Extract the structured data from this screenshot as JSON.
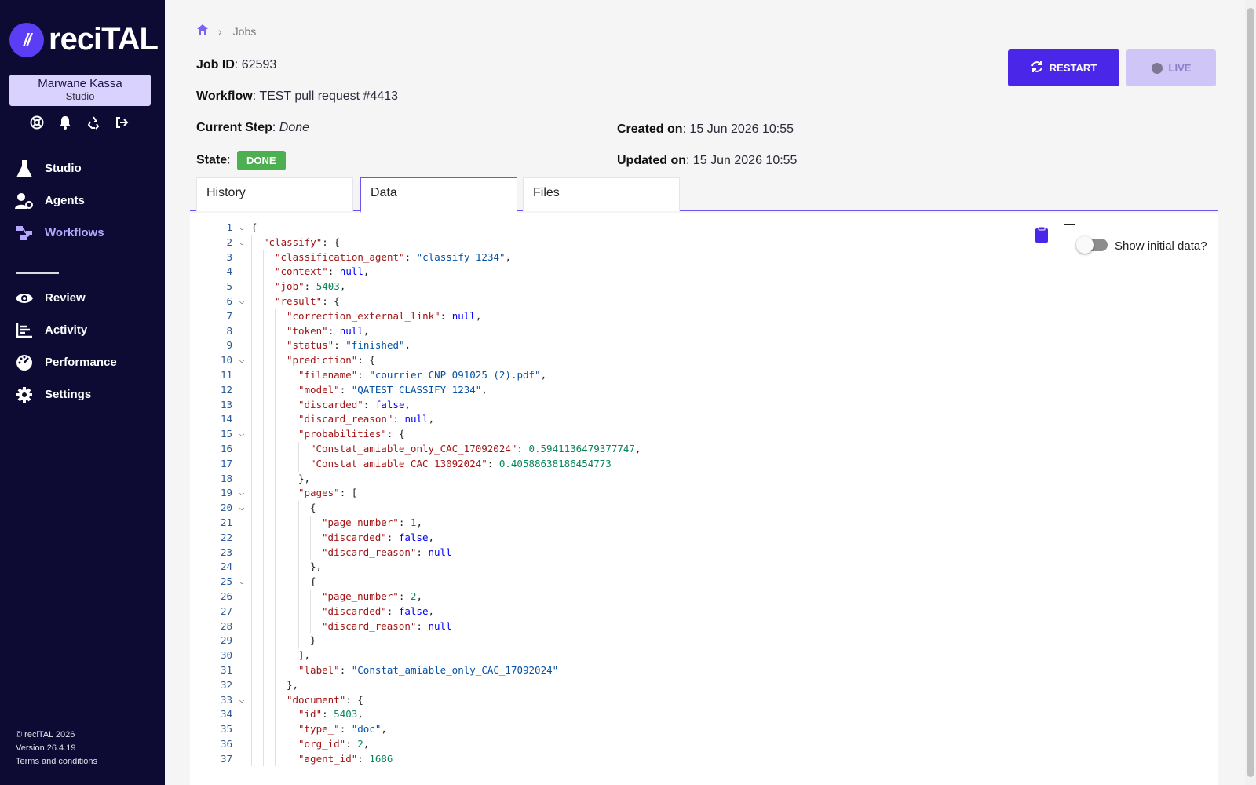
{
  "app": {
    "logo_text": "reciTAL",
    "logo_mark": "//"
  },
  "user": {
    "name": "Marwane Kassa",
    "role": "Studio"
  },
  "util_icons": [
    "support-icon",
    "bell-icon",
    "recycle-icon",
    "logout-icon"
  ],
  "nav": {
    "primary": [
      {
        "label": "Studio",
        "icon": "flask-icon"
      },
      {
        "label": "Agents",
        "icon": "agents-icon"
      },
      {
        "label": "Workflows",
        "icon": "workflow-icon",
        "active": true
      }
    ],
    "secondary": [
      {
        "label": "Review",
        "icon": "eye-icon"
      },
      {
        "label": "Activity",
        "icon": "activity-icon"
      },
      {
        "label": "Performance",
        "icon": "gauge-icon"
      },
      {
        "label": "Settings",
        "icon": "gear-icon"
      }
    ]
  },
  "footer": {
    "copyright": "© reciTAL 2026",
    "version": "Version 26.4.19",
    "terms": "Terms and conditions"
  },
  "breadcrumb": {
    "home_icon": "home-icon",
    "current": "Jobs"
  },
  "job": {
    "id_label": "Job ID",
    "id_value": "62593",
    "workflow_label": "Workflow",
    "workflow_value": "TEST pull request #4413",
    "step_label": "Current Step",
    "step_value": "Done",
    "state_label": "State",
    "state_value": "DONE",
    "created_label": "Created on",
    "created_value": "15 Jun 2026 10:55",
    "updated_label": "Updated on",
    "updated_value": "15 Jun 2026 10:55"
  },
  "actions": {
    "restart_label": "RESTART",
    "live_label": "LIVE"
  },
  "tabs": [
    {
      "label": "History"
    },
    {
      "label": "Data",
      "active": true
    },
    {
      "label": "Files"
    }
  ],
  "toggle": {
    "label": "Show initial data?",
    "checked": false
  },
  "colors": {
    "sidebar_bg": "#0d0a33",
    "accent": "#4a26e8",
    "done_badge": "#4cb050"
  },
  "code_lines": [
    {
      "n": "1",
      "fold": true,
      "indent": 0,
      "t": [
        [
          "p",
          "{"
        ]
      ]
    },
    {
      "n": "2",
      "fold": true,
      "indent": 1,
      "t": [
        [
          "k",
          "\"classify\""
        ],
        [
          "p",
          ": {"
        ]
      ]
    },
    {
      "n": "3",
      "fold": false,
      "indent": 2,
      "t": [
        [
          "k",
          "\"classification_agent\""
        ],
        [
          "p",
          ": "
        ],
        [
          "s",
          "\"classify 1234\""
        ],
        [
          "p",
          ","
        ]
      ]
    },
    {
      "n": "4",
      "fold": false,
      "indent": 2,
      "t": [
        [
          "k",
          "\"context\""
        ],
        [
          "p",
          ": "
        ],
        [
          "kw",
          "null"
        ],
        [
          "p",
          ","
        ]
      ]
    },
    {
      "n": "5",
      "fold": false,
      "indent": 2,
      "t": [
        [
          "k",
          "\"job\""
        ],
        [
          "p",
          ": "
        ],
        [
          "n",
          "5403"
        ],
        [
          "p",
          ","
        ]
      ]
    },
    {
      "n": "6",
      "fold": true,
      "indent": 2,
      "t": [
        [
          "k",
          "\"result\""
        ],
        [
          "p",
          ": {"
        ]
      ]
    },
    {
      "n": "7",
      "fold": false,
      "indent": 3,
      "t": [
        [
          "k",
          "\"correction_external_link\""
        ],
        [
          "p",
          ": "
        ],
        [
          "kw",
          "null"
        ],
        [
          "p",
          ","
        ]
      ]
    },
    {
      "n": "8",
      "fold": false,
      "indent": 3,
      "t": [
        [
          "k",
          "\"token\""
        ],
        [
          "p",
          ": "
        ],
        [
          "kw",
          "null"
        ],
        [
          "p",
          ","
        ]
      ]
    },
    {
      "n": "9",
      "fold": false,
      "indent": 3,
      "t": [
        [
          "k",
          "\"status\""
        ],
        [
          "p",
          ": "
        ],
        [
          "s",
          "\"finished\""
        ],
        [
          "p",
          ","
        ]
      ]
    },
    {
      "n": "10",
      "fold": true,
      "indent": 3,
      "t": [
        [
          "k",
          "\"prediction\""
        ],
        [
          "p",
          ": {"
        ]
      ]
    },
    {
      "n": "11",
      "fold": false,
      "indent": 4,
      "t": [
        [
          "k",
          "\"filename\""
        ],
        [
          "p",
          ": "
        ],
        [
          "s",
          "\"courrier CNP 091025 (2).pdf\""
        ],
        [
          "p",
          ","
        ]
      ]
    },
    {
      "n": "12",
      "fold": false,
      "indent": 4,
      "t": [
        [
          "k",
          "\"model\""
        ],
        [
          "p",
          ": "
        ],
        [
          "s",
          "\"QATEST CLASSIFY 1234\""
        ],
        [
          "p",
          ","
        ]
      ]
    },
    {
      "n": "13",
      "fold": false,
      "indent": 4,
      "t": [
        [
          "k",
          "\"discarded\""
        ],
        [
          "p",
          ": "
        ],
        [
          "kw",
          "false"
        ],
        [
          "p",
          ","
        ]
      ]
    },
    {
      "n": "14",
      "fold": false,
      "indent": 4,
      "t": [
        [
          "k",
          "\"discard_reason\""
        ],
        [
          "p",
          ": "
        ],
        [
          "kw",
          "null"
        ],
        [
          "p",
          ","
        ]
      ]
    },
    {
      "n": "15",
      "fold": true,
      "indent": 4,
      "t": [
        [
          "k",
          "\"probabilities\""
        ],
        [
          "p",
          ": {"
        ]
      ]
    },
    {
      "n": "16",
      "fold": false,
      "indent": 5,
      "t": [
        [
          "k",
          "\"Constat_amiable_only_CAC_17092024\""
        ],
        [
          "p",
          ": "
        ],
        [
          "n",
          "0.5941136479377747"
        ],
        [
          "p",
          ","
        ]
      ]
    },
    {
      "n": "17",
      "fold": false,
      "indent": 5,
      "t": [
        [
          "k",
          "\"Constat_amiable_CAC_13092024\""
        ],
        [
          "p",
          ": "
        ],
        [
          "n",
          "0.40588638186454773"
        ]
      ]
    },
    {
      "n": "18",
      "fold": false,
      "indent": 4,
      "t": [
        [
          "p",
          "},"
        ]
      ]
    },
    {
      "n": "19",
      "fold": true,
      "indent": 4,
      "t": [
        [
          "k",
          "\"pages\""
        ],
        [
          "p",
          ": ["
        ]
      ]
    },
    {
      "n": "20",
      "fold": true,
      "indent": 5,
      "t": [
        [
          "p",
          "{"
        ]
      ]
    },
    {
      "n": "21",
      "fold": false,
      "indent": 6,
      "t": [
        [
          "k",
          "\"page_number\""
        ],
        [
          "p",
          ": "
        ],
        [
          "n",
          "1"
        ],
        [
          "p",
          ","
        ]
      ]
    },
    {
      "n": "22",
      "fold": false,
      "indent": 6,
      "t": [
        [
          "k",
          "\"discarded\""
        ],
        [
          "p",
          ": "
        ],
        [
          "kw",
          "false"
        ],
        [
          "p",
          ","
        ]
      ]
    },
    {
      "n": "23",
      "fold": false,
      "indent": 6,
      "t": [
        [
          "k",
          "\"discard_reason\""
        ],
        [
          "p",
          ": "
        ],
        [
          "kw",
          "null"
        ]
      ]
    },
    {
      "n": "24",
      "fold": false,
      "indent": 5,
      "t": [
        [
          "p",
          "},"
        ]
      ]
    },
    {
      "n": "25",
      "fold": true,
      "indent": 5,
      "t": [
        [
          "p",
          "{"
        ]
      ]
    },
    {
      "n": "26",
      "fold": false,
      "indent": 6,
      "t": [
        [
          "k",
          "\"page_number\""
        ],
        [
          "p",
          ": "
        ],
        [
          "n",
          "2"
        ],
        [
          "p",
          ","
        ]
      ]
    },
    {
      "n": "27",
      "fold": false,
      "indent": 6,
      "t": [
        [
          "k",
          "\"discarded\""
        ],
        [
          "p",
          ": "
        ],
        [
          "kw",
          "false"
        ],
        [
          "p",
          ","
        ]
      ]
    },
    {
      "n": "28",
      "fold": false,
      "indent": 6,
      "t": [
        [
          "k",
          "\"discard_reason\""
        ],
        [
          "p",
          ": "
        ],
        [
          "kw",
          "null"
        ]
      ]
    },
    {
      "n": "29",
      "fold": false,
      "indent": 5,
      "t": [
        [
          "p",
          "}"
        ]
      ]
    },
    {
      "n": "30",
      "fold": false,
      "indent": 4,
      "t": [
        [
          "p",
          "],"
        ]
      ]
    },
    {
      "n": "31",
      "fold": false,
      "indent": 4,
      "t": [
        [
          "k",
          "\"label\""
        ],
        [
          "p",
          ": "
        ],
        [
          "s",
          "\"Constat_amiable_only_CAC_17092024\""
        ]
      ]
    },
    {
      "n": "32",
      "fold": false,
      "indent": 3,
      "t": [
        [
          "p",
          "},"
        ]
      ]
    },
    {
      "n": "33",
      "fold": true,
      "indent": 3,
      "t": [
        [
          "k",
          "\"document\""
        ],
        [
          "p",
          ": {"
        ]
      ]
    },
    {
      "n": "34",
      "fold": false,
      "indent": 4,
      "t": [
        [
          "k",
          "\"id\""
        ],
        [
          "p",
          ": "
        ],
        [
          "n",
          "5403"
        ],
        [
          "p",
          ","
        ]
      ]
    },
    {
      "n": "35",
      "fold": false,
      "indent": 4,
      "t": [
        [
          "k",
          "\"type_\""
        ],
        [
          "p",
          ": "
        ],
        [
          "s",
          "\"doc\""
        ],
        [
          "p",
          ","
        ]
      ]
    },
    {
      "n": "36",
      "fold": false,
      "indent": 4,
      "t": [
        [
          "k",
          "\"org_id\""
        ],
        [
          "p",
          ": "
        ],
        [
          "n",
          "2"
        ],
        [
          "p",
          ","
        ]
      ]
    },
    {
      "n": "37",
      "fold": false,
      "indent": 4,
      "t": [
        [
          "k",
          "\"agent_id\""
        ],
        [
          "p",
          ": "
        ],
        [
          "n",
          "1686"
        ]
      ]
    }
  ]
}
